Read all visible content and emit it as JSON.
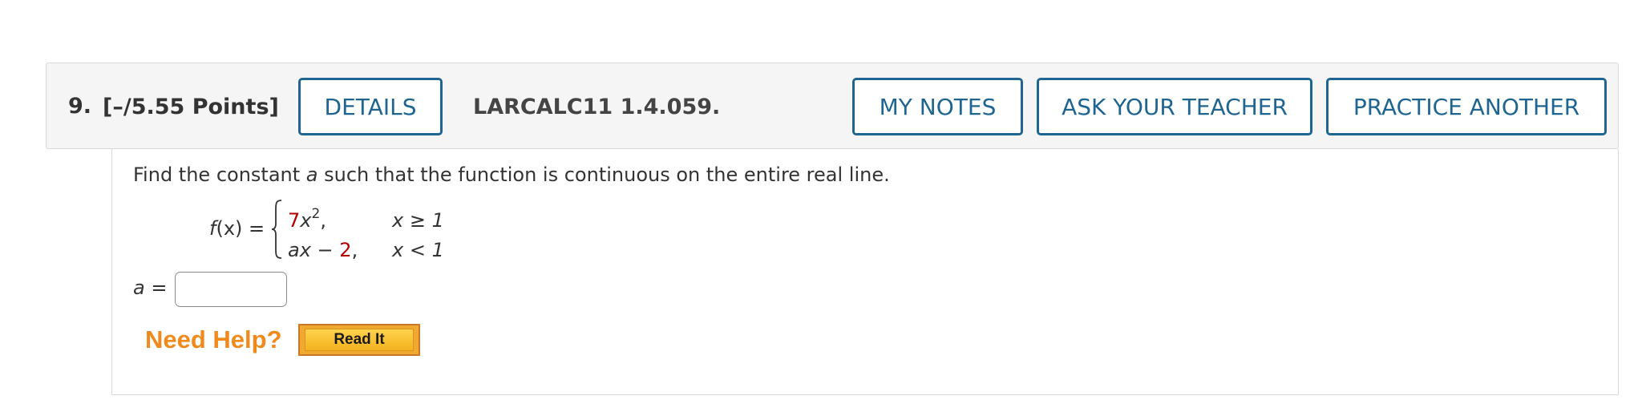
{
  "question": {
    "number": "9.",
    "points": "[–/5.55 Points]",
    "reference": "LARCALC11 1.4.059."
  },
  "buttons": {
    "details": "DETAILS",
    "my_notes": "MY NOTES",
    "ask_teacher": "ASK YOUR TEACHER",
    "practice_another": "PRACTICE ANOTHER"
  },
  "problem": {
    "prompt_before": "Find the constant ",
    "prompt_var": "a",
    "prompt_after": " such that the function is continuous on the entire real line.",
    "function_lhs_f": "f",
    "function_lhs_rest": "(x) =",
    "case1": {
      "coef": "7",
      "var": "x",
      "exp": "2",
      "tail": ",",
      "condition": "x ≥ 1"
    },
    "case2": {
      "var": "ax",
      "op": " − ",
      "const": "2",
      "tail": ",",
      "condition": "x < 1"
    }
  },
  "answer": {
    "label_var": "a",
    "label_eq": " =",
    "value": ""
  },
  "help": {
    "need_help": "Need Help?",
    "read_it": "Read It"
  },
  "colors": {
    "button_border": "#1f6591",
    "highlight_red": "#b30000",
    "need_help_orange": "#f08a1c"
  }
}
